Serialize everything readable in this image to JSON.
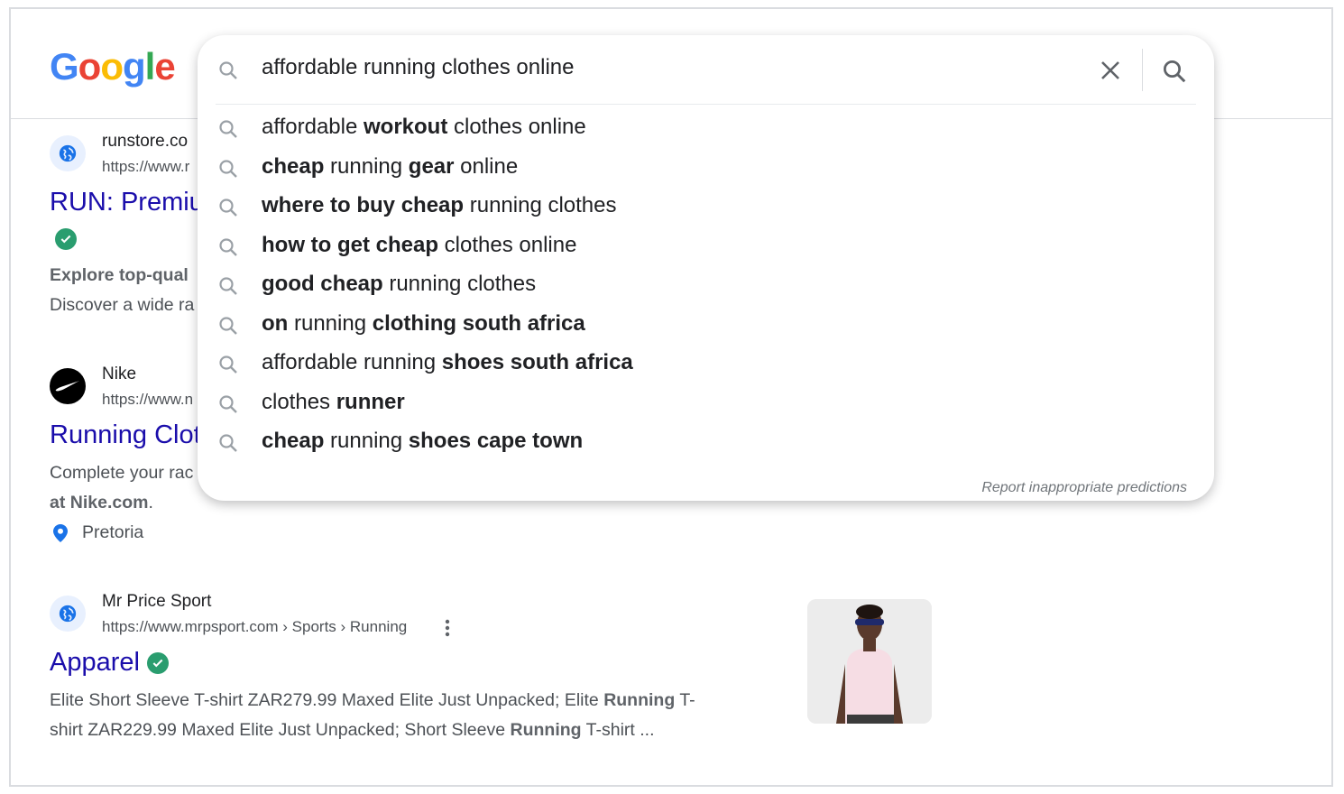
{
  "logo": {
    "letters": [
      "G",
      "o",
      "o",
      "g",
      "l",
      "e"
    ],
    "colors": [
      "#4285f4",
      "#ea4335",
      "#fbbc05",
      "#4285f4",
      "#34a853",
      "#ea4335"
    ]
  },
  "search": {
    "query": "affordable running clothes online",
    "suggestions": [
      {
        "parts": [
          [
            "affordable ",
            false
          ],
          [
            "workout",
            true
          ],
          [
            " clothes online",
            false
          ]
        ]
      },
      {
        "parts": [
          [
            "cheap",
            true
          ],
          [
            " running ",
            false
          ],
          [
            "gear",
            true
          ],
          [
            " online",
            false
          ]
        ]
      },
      {
        "parts": [
          [
            "where to buy cheap",
            true
          ],
          [
            " running clothes",
            false
          ]
        ]
      },
      {
        "parts": [
          [
            "how to get cheap",
            true
          ],
          [
            " clothes online",
            false
          ]
        ]
      },
      {
        "parts": [
          [
            "good cheap",
            true
          ],
          [
            " running clothes",
            false
          ]
        ]
      },
      {
        "parts": [
          [
            "on",
            true
          ],
          [
            " running ",
            false
          ],
          [
            "clothing south africa",
            true
          ]
        ]
      },
      {
        "parts": [
          [
            "affordable running ",
            false
          ],
          [
            "shoes south africa",
            true
          ]
        ]
      },
      {
        "parts": [
          [
            "clothes ",
            false
          ],
          [
            "runner",
            true
          ]
        ]
      },
      {
        "parts": [
          [
            "cheap",
            true
          ],
          [
            " running ",
            false
          ],
          [
            "shoes cape town",
            true
          ]
        ]
      }
    ],
    "report_link": "Report inappropriate predictions"
  },
  "results": [
    {
      "site_name": "runstore.co",
      "url": "https://www.r",
      "title": "RUN: Premiu",
      "snippet_bold": "Explore top-qual",
      "snippet": "Discover a wide ra"
    },
    {
      "site_name": "Nike",
      "url": "https://www.n",
      "title": "Running Clot",
      "snippet_line1": "Complete your rac",
      "snippet_line2_bold": "at Nike.com",
      "snippet_line2_end": ".",
      "location": "Pretoria"
    },
    {
      "site_name": "Mr Price Sport",
      "url": "https://www.mrpsport.com › Sports › Running",
      "title": "Apparel",
      "snippet_line1": [
        [
          "Elite Short Sleeve T-shirt ZAR279.99 Maxed Elite Just Unpacked; Elite ",
          false
        ],
        [
          "Running",
          true
        ],
        [
          " T-",
          false
        ]
      ],
      "snippet_line2": [
        [
          "shirt ZAR229.99 Maxed Elite Just Unpacked; Short Sleeve ",
          false
        ],
        [
          "Running",
          true
        ],
        [
          " T-shirt ...",
          false
        ]
      ]
    }
  ]
}
